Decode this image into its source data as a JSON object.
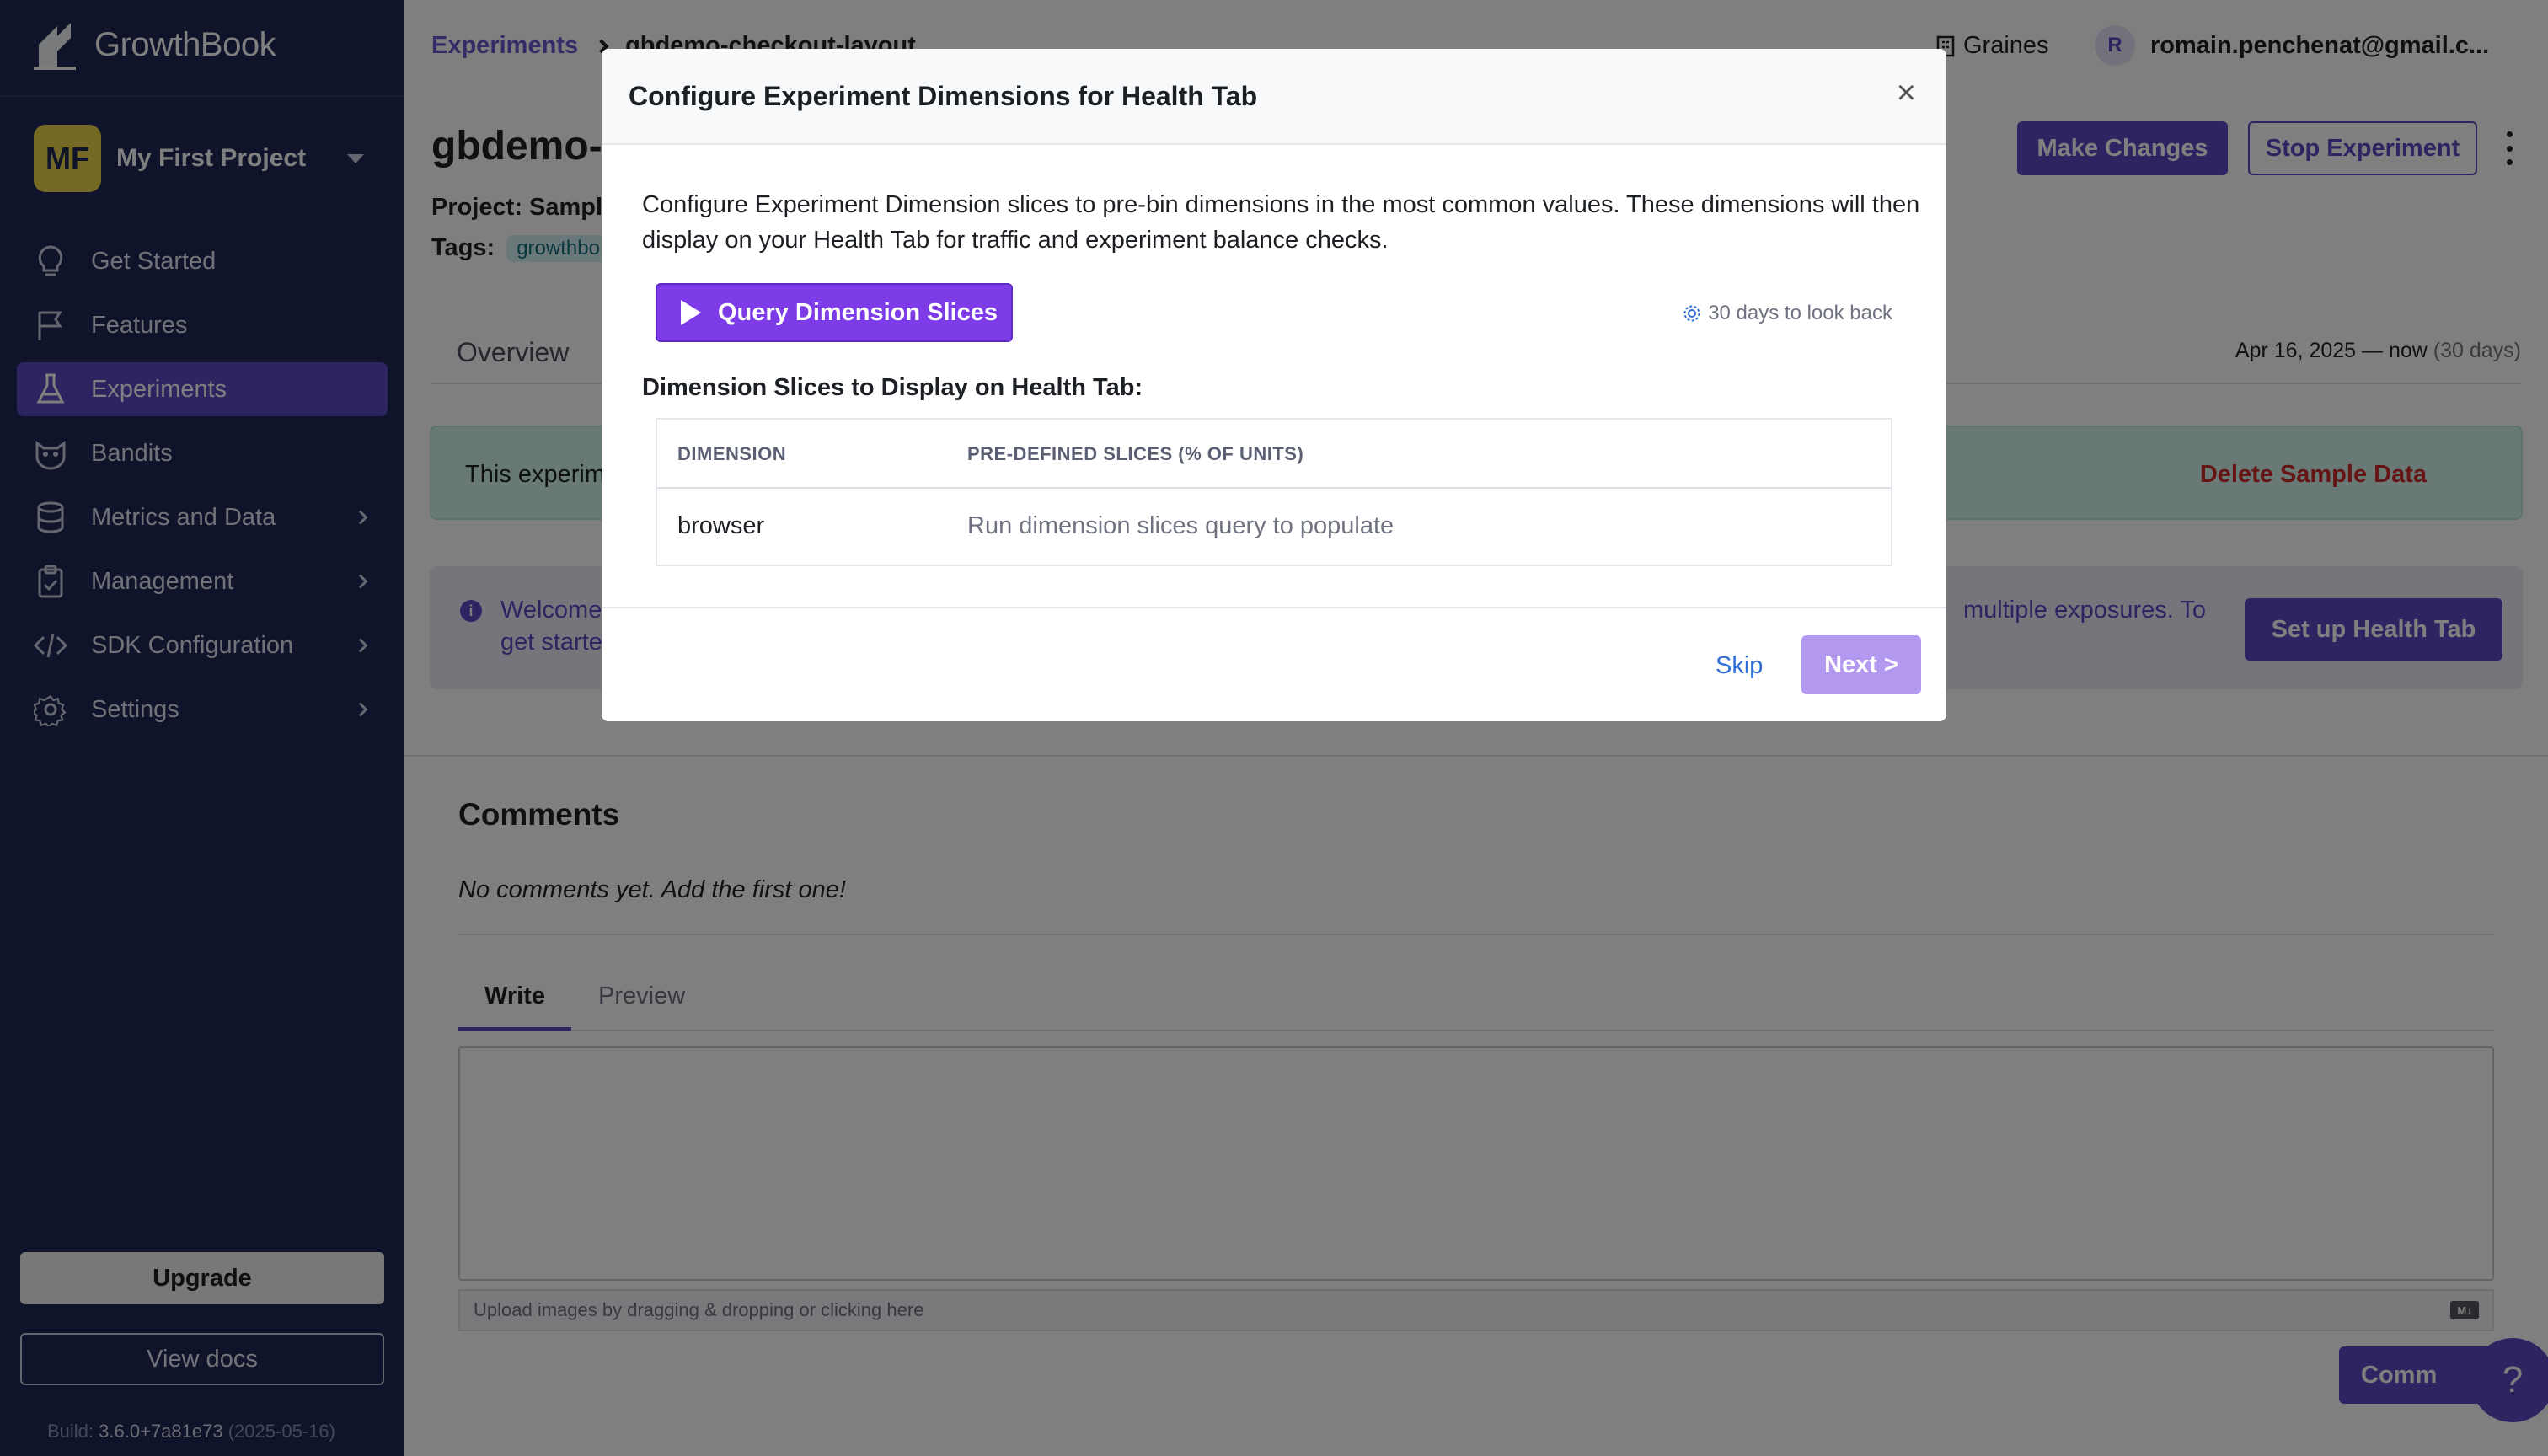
{
  "sidebar": {
    "brand": "GrowthBook",
    "project": {
      "initials": "MF",
      "name": "My First Project"
    },
    "items": [
      {
        "label": "Get Started",
        "icon": "lightbulb-icon"
      },
      {
        "label": "Features",
        "icon": "flag-icon"
      },
      {
        "label": "Experiments",
        "icon": "flask-icon",
        "active": true
      },
      {
        "label": "Bandits",
        "icon": "bandit-icon"
      },
      {
        "label": "Metrics and Data",
        "icon": "database-icon"
      },
      {
        "label": "Management",
        "icon": "clipboard-icon"
      },
      {
        "label": "SDK Configuration",
        "icon": "code-icon"
      },
      {
        "label": "Settings",
        "icon": "gear-icon"
      }
    ],
    "upgrade_label": "Upgrade",
    "docs_label": "View docs",
    "build_label": "Build:",
    "build_version": "3.6.0+7a81e73",
    "build_date": "(2025-05-16)"
  },
  "header": {
    "breadcrumb_root": "Experiments",
    "breadcrumb_current": "gbdemo-checkout-layout",
    "org_name": "Graines",
    "user_initial": "R",
    "user_email": "romain.penchenat@gmail.c..."
  },
  "experiment": {
    "title": "gbdemo-",
    "project_label": "Project:",
    "project_value": "Sampl",
    "tags_label": "Tags:",
    "tag": "growthbo",
    "make_changes_label": "Make Changes",
    "stop_label": "Stop Experiment",
    "overview_tab": "Overview",
    "date_range": "Apr 16, 2025 — now",
    "date_range_days": "(30 days)",
    "sample_banner_text": "This experim",
    "delete_sample_label": "Delete Sample Data",
    "welcome_text_1": "Welcome",
    "welcome_text_2": "get starte",
    "welcome_tail": "multiple exposures. To",
    "setup_health_label": "Set up Health Tab"
  },
  "comments": {
    "title": "Comments",
    "empty_text": "No comments yet. Add the first one!",
    "write_tab": "Write",
    "preview_tab": "Preview",
    "upload_hint": "Upload images by dragging & dropping or clicking here",
    "markdown_badge": "M↓",
    "submit_label": "Comm",
    "help_label": "?"
  },
  "modal": {
    "title": "Configure Experiment Dimensions for Health Tab",
    "close_label": "×",
    "description": "Configure Experiment Dimension slices to pre-bin dimensions in the most common values. These dimensions will then display on your Health Tab for traffic and experiment balance checks.",
    "query_button_label": "Query Dimension Slices",
    "lookback_label": "30 days to look back",
    "slices_title": "Dimension Slices to Display on Health Tab:",
    "table": {
      "headers": [
        "DIMENSION",
        "PRE-DEFINED SLICES (% OF UNITS)"
      ],
      "rows": [
        [
          "browser",
          "Run dimension slices query to populate"
        ]
      ]
    },
    "skip_label": "Skip",
    "next_label": "Next >"
  },
  "colors": {
    "sidebar_bg": "#1f2856",
    "accent": "#5b4bc4",
    "query_button": "#7d3ce8",
    "next_disabled": "#b398ef",
    "danger": "#cc2b2b",
    "link": "#2f6fd6"
  }
}
